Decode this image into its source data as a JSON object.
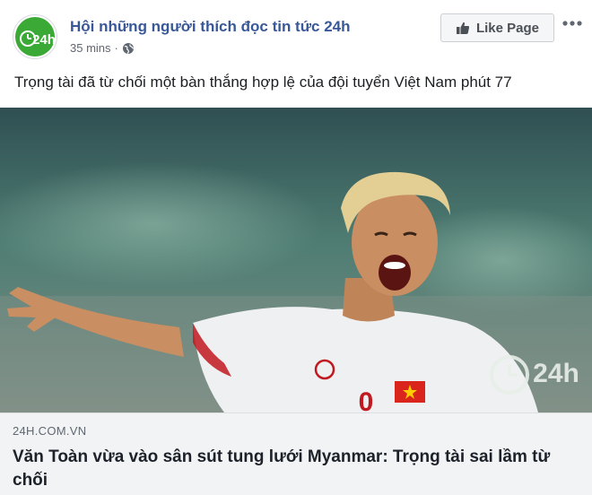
{
  "header": {
    "page_name": "Hội những người thích đọc tin tức 24h",
    "timestamp": "35 mins",
    "separator": "·",
    "privacy_icon": "globe-icon",
    "like_button_label": "Like Page",
    "like_icon": "thumbs-up-icon",
    "more_icon": "more-options-icon",
    "avatar_logo": "24h"
  },
  "post": {
    "message": "Trọng tài đã từ chối một bàn thắng hợp lệ của đội tuyển Việt Nam phút 77"
  },
  "link": {
    "image_watermark": "24h",
    "jersey_number": "0",
    "domain": "24H.COM.VN",
    "title": "Văn Toàn vừa vào sân sút tung lưới Myanmar: Trọng tài sai lầm từ chối"
  },
  "colors": {
    "page_name": "#385898",
    "logo_green": "#3aa935",
    "link_background": "#f2f3f5"
  }
}
